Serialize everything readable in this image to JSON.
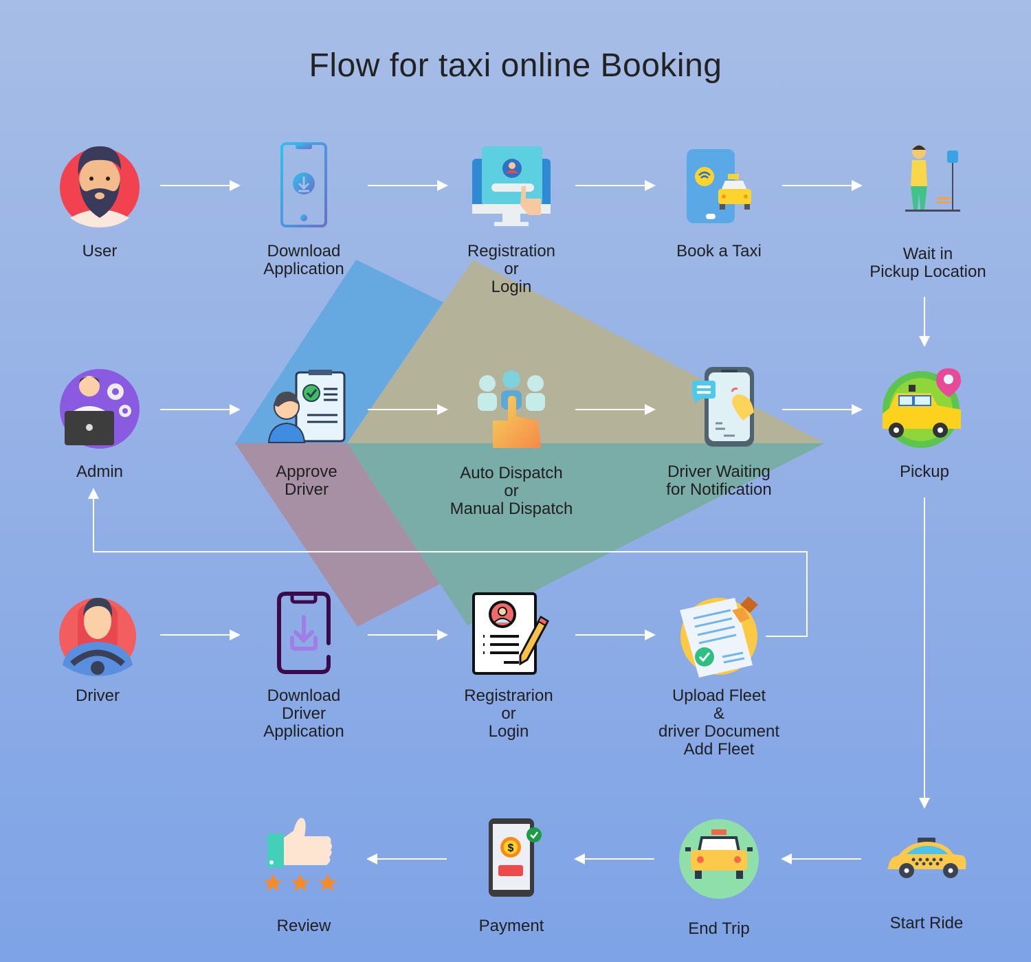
{
  "title": "Flow for taxi online Booking",
  "colors": {
    "arrow": "#ffffff",
    "shape_blue": "#66a9e0",
    "shape_khaki": "#b4b399",
    "shape_mauve": "#a790a3",
    "shape_teal": "#7aaca8"
  },
  "rows": {
    "user": [
      {
        "id": "user",
        "label": "User",
        "icon": "bearded-man-avatar-icon"
      },
      {
        "id": "download-application",
        "label": "Download\nApplication",
        "icon": "phone-download-icon"
      },
      {
        "id": "registration-or-login",
        "label": "Registration\nor\nLogin",
        "icon": "monitor-login-icon"
      },
      {
        "id": "book-a-taxi",
        "label": "Book a Taxi",
        "icon": "phone-taxi-icon"
      },
      {
        "id": "wait-in-pickup-location",
        "label": "Wait in\nPickup Location",
        "icon": "bus-stop-person-icon"
      }
    ],
    "admin": [
      {
        "id": "admin",
        "label": "Admin",
        "icon": "admin-laptop-gears-icon"
      },
      {
        "id": "approve-driver",
        "label": "Approve\nDriver",
        "icon": "clipboard-approve-icon"
      },
      {
        "id": "auto-or-manual-dispatch",
        "label": "Auto Dispatch\nor\nManual Dispatch",
        "icon": "hand-select-people-icon"
      },
      {
        "id": "driver-waiting-for-notification",
        "label": "Driver Waiting\nfor Notification",
        "icon": "phone-notification-bell-icon"
      },
      {
        "id": "pickup",
        "label": "Pickup",
        "icon": "taxi-location-pin-icon"
      }
    ],
    "driver": [
      {
        "id": "driver",
        "label": "Driver",
        "icon": "driver-steering-wheel-icon"
      },
      {
        "id": "download-driver-application",
        "label": "Download\nDriver\nApplication",
        "icon": "phone-download-outline-icon"
      },
      {
        "id": "driver-registration-or-login",
        "label": "Registrarion\nor\nLogin",
        "icon": "document-pencil-icon"
      },
      {
        "id": "upload-fleet-driver-document",
        "label": "Upload Fleet\n&\ndriver Document\nAdd Fleet",
        "icon": "stamped-document-icon"
      }
    ],
    "trip": [
      {
        "id": "review",
        "label": "Review",
        "icon": "thumbs-up-stars-icon"
      },
      {
        "id": "payment",
        "label": "Payment",
        "icon": "phone-payment-icon"
      },
      {
        "id": "end-trip",
        "label": "End Trip",
        "icon": "taxi-front-icon"
      },
      {
        "id": "start-ride",
        "label": "Start Ride",
        "icon": "taxi-side-icon"
      }
    ]
  }
}
